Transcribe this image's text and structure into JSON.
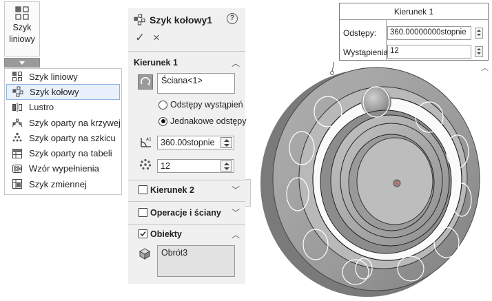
{
  "toolbar": {
    "button_label": "Szyk liniowy",
    "button_icon": "linear-pattern-icon",
    "dropdown_icon": "triangle-down-icon"
  },
  "menu": {
    "items": [
      {
        "label": "Szyk liniowy",
        "icon": "linear-pattern-icon",
        "selected": false
      },
      {
        "label": "Szyk kołowy",
        "icon": "circular-pattern-icon",
        "selected": true
      },
      {
        "label": "Lustro",
        "icon": "mirror-icon",
        "selected": false
      },
      {
        "label": "Szyk oparty na krzywej",
        "icon": "curve-pattern-icon",
        "selected": false
      },
      {
        "label": "Szyk oparty na szkicu",
        "icon": "sketch-pattern-icon",
        "selected": false
      },
      {
        "label": "Szyk oparty na tabeli",
        "icon": "table-pattern-icon",
        "selected": false
      },
      {
        "label": "Wzór wypełnienia",
        "icon": "fill-pattern-icon",
        "selected": false
      },
      {
        "label": "Szyk zmiennej",
        "icon": "variable-pattern-icon",
        "selected": false
      }
    ]
  },
  "property_manager": {
    "title": "Szyk kołowy1",
    "help": "?",
    "ok": "✓",
    "cancel": "×",
    "direction1": {
      "title": "Kierunek 1",
      "axis_value": "Ściana<1>",
      "radio_instance_spacing": "Odstępy wystąpień",
      "radio_equal_spacing": "Jednakowe odstępy",
      "equal_spacing_selected": true,
      "angle_value": "360.00stopnie",
      "instances_value": "12"
    },
    "direction2": {
      "title": "Kierunek 2",
      "checked": false
    },
    "features_faces": {
      "title": "Operacje i ściany",
      "checked": false
    },
    "bodies": {
      "title": "Obiekty",
      "checked": true,
      "value": "Obrót3"
    }
  },
  "callout": {
    "title": "Kierunek 1",
    "spacing_label": "Odstępy:",
    "spacing_value": "360.00000000stopnie",
    "instances_label": "Wystąpienia:",
    "instances_value": "12"
  },
  "colors": {
    "panel_bg": "#f0f0f0",
    "selection_bg": "#e8f0fb",
    "selection_border": "#8fb3e0",
    "model_gray": "#9e9e9e"
  }
}
